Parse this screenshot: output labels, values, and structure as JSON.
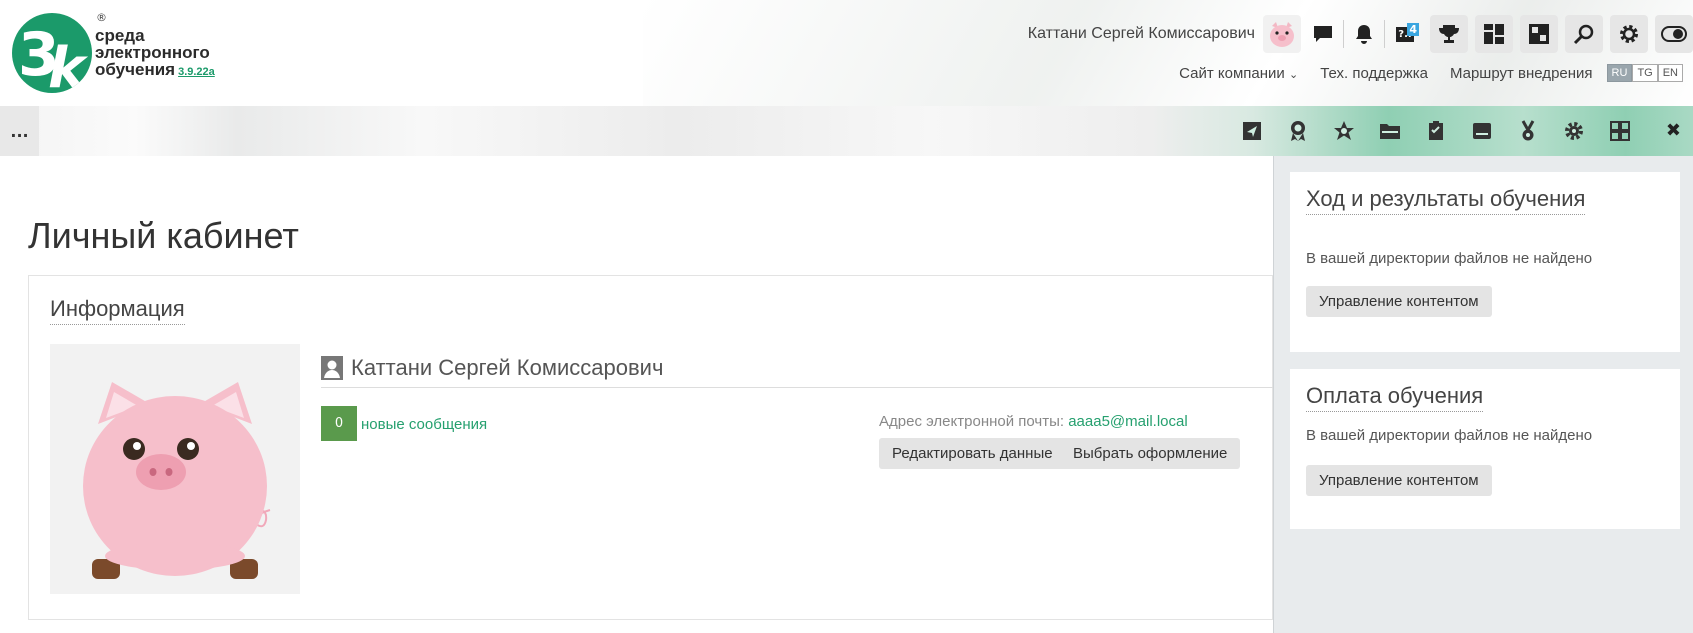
{
  "logo": {
    "line1": "среда",
    "line2": "электронного",
    "line3": "обучения",
    "version": "3.9.22a",
    "registered": "®"
  },
  "header": {
    "user_name": "Каттани Сергей Комиссарович",
    "help_badge_label": "?..",
    "help_badge_count": "4",
    "nav": {
      "company_site": "Сайт компании",
      "support": "Тех. поддержка",
      "route": "Маршрут внедрения"
    },
    "languages": [
      "RU",
      "TG",
      "EN"
    ],
    "active_language": "RU"
  },
  "toolbar": {
    "menu_label": "...",
    "close_label": "✖"
  },
  "main": {
    "page_title": "Личный кабинет",
    "info": {
      "title": "Информация",
      "full_name": "Каттани Сергей Комиссарович",
      "messages_count": "0",
      "messages_label": "новые сообщения",
      "email_label": "Адрес электронной почты:",
      "email_value": "aaaa5@mail.local",
      "edit_button": "Редактировать данные",
      "theme_button": "Выбрать оформление"
    }
  },
  "sidebar": {
    "cards": [
      {
        "title": "Ход и результаты обучения",
        "text": "В вашей директории файлов не найдено",
        "button": "Управление контентом"
      },
      {
        "title": "Оплата обучения",
        "text": "В вашей директории файлов не найдено",
        "button": "Управление контентом"
      }
    ]
  },
  "colors": {
    "brand_green": "#1b9a6a",
    "link_green": "#26a06f",
    "message_badge": "#5a9a4c",
    "sidebar_bg": "#e8ebed"
  }
}
